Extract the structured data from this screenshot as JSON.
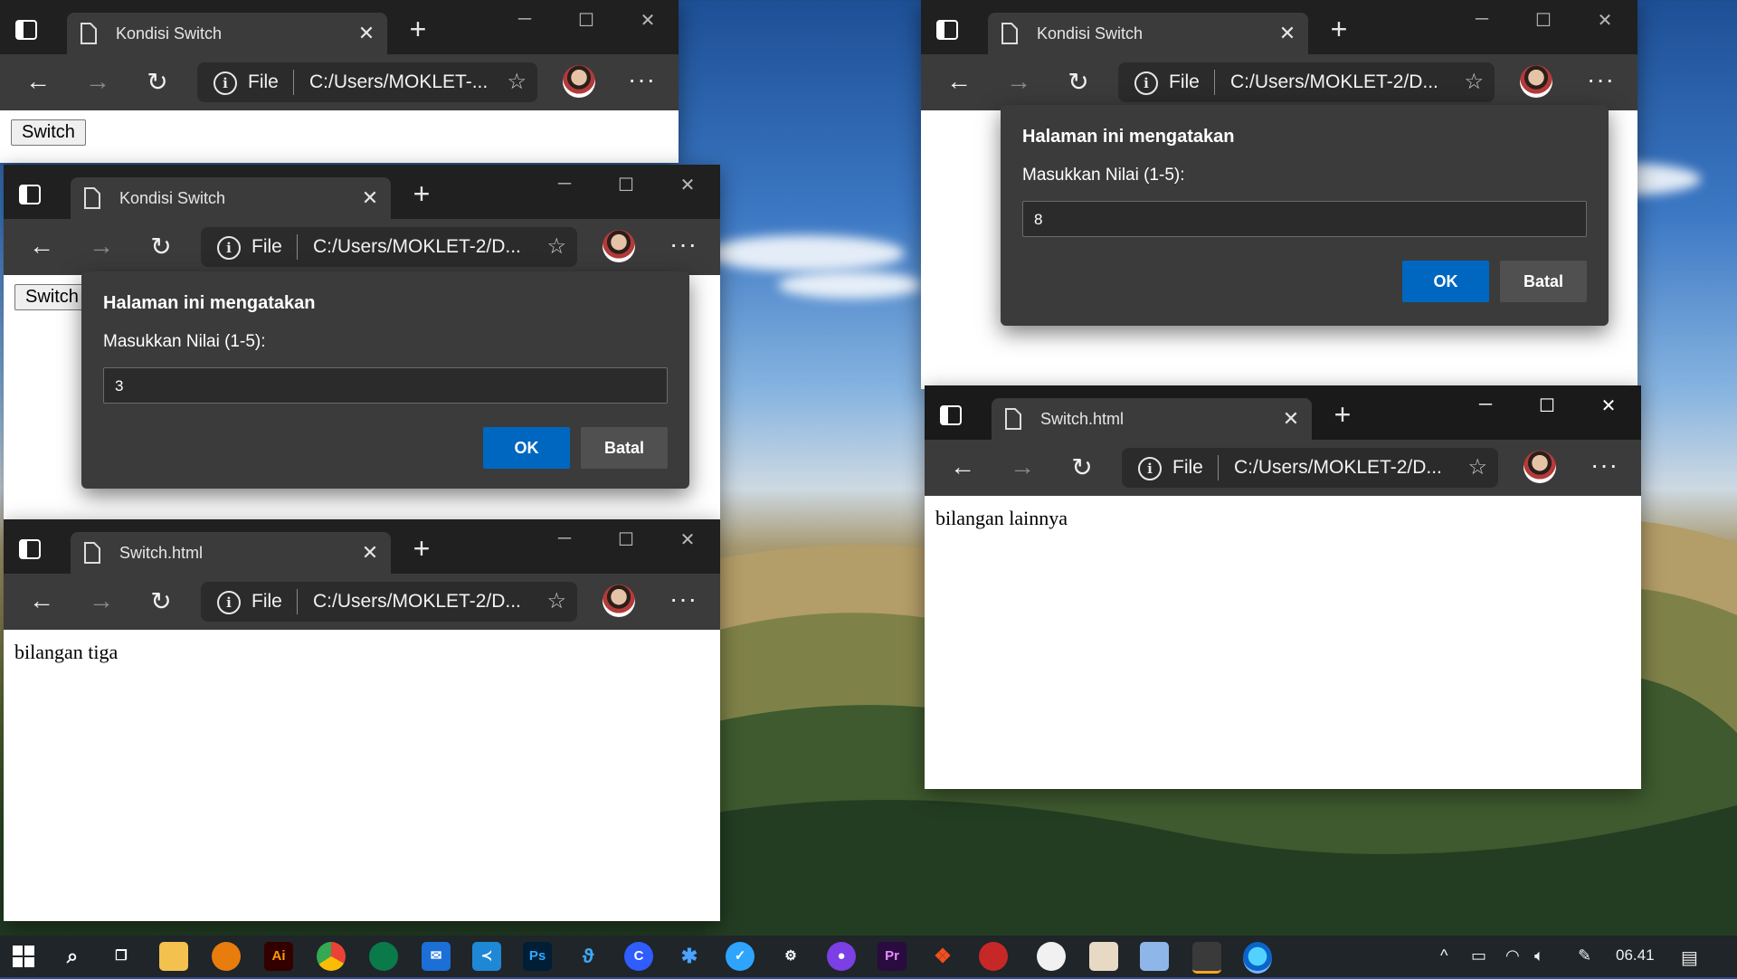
{
  "windows": {
    "w1": {
      "tab_title": "Kondisi Switch",
      "file_label": "File",
      "url": "C:/Users/MOKLET-...",
      "button_label": "Switch"
    },
    "w2": {
      "tab_title": "Kondisi Switch",
      "file_label": "File",
      "url": "C:/Users/MOKLET-2/D...",
      "button_label": "Switch",
      "dialog": {
        "title": "Halaman ini mengatakan",
        "label": "Masukkan Nilai (1-5):",
        "value": "3",
        "ok": "OK",
        "cancel": "Batal"
      }
    },
    "w3": {
      "tab_title": "Switch.html",
      "file_label": "File",
      "url": "C:/Users/MOKLET-2/D...",
      "body_text": "bilangan tiga"
    },
    "w4": {
      "tab_title": "Kondisi Switch",
      "file_label": "File",
      "url": "C:/Users/MOKLET-2/D...",
      "dialog": {
        "title": "Halaman ini mengatakan",
        "label": "Masukkan Nilai (1-5):",
        "value": "8",
        "ok": "OK",
        "cancel": "Batal"
      }
    },
    "w5": {
      "tab_title": "Switch.html",
      "file_label": "File",
      "url": "C:/Users/MOKLET-2/D...",
      "body_text": "bilangan lainnya"
    }
  },
  "taskbar": {
    "icons": [
      "windows-start-icon",
      "search-icon",
      "task-view-icon",
      "file-explorer-icon",
      "blender-icon",
      "illustrator-icon",
      "chrome-icon",
      "edge-dev-icon",
      "mail-icon",
      "vscode-icon",
      "photoshop-icon",
      "app-icon",
      "cortana-icon",
      "tool-icon",
      "app-icon-2",
      "network-app-icon",
      "github-icon",
      "premiere-icon",
      "figma-icon",
      "app-icon-3",
      "app-icon-4",
      "app-icon-5",
      "cube-icon",
      "visual-studio-icon",
      "edge-icon"
    ],
    "ai_text": "Ai",
    "ps_text": "Ps",
    "pr_text": "Pr",
    "clock": "06.41"
  },
  "colors": {
    "titlebar": "#202020",
    "toolbar": "#3b3b3b",
    "dialog": "#3b3b3b",
    "ok_button": "#0067c0",
    "cancel_button": "#505050"
  }
}
